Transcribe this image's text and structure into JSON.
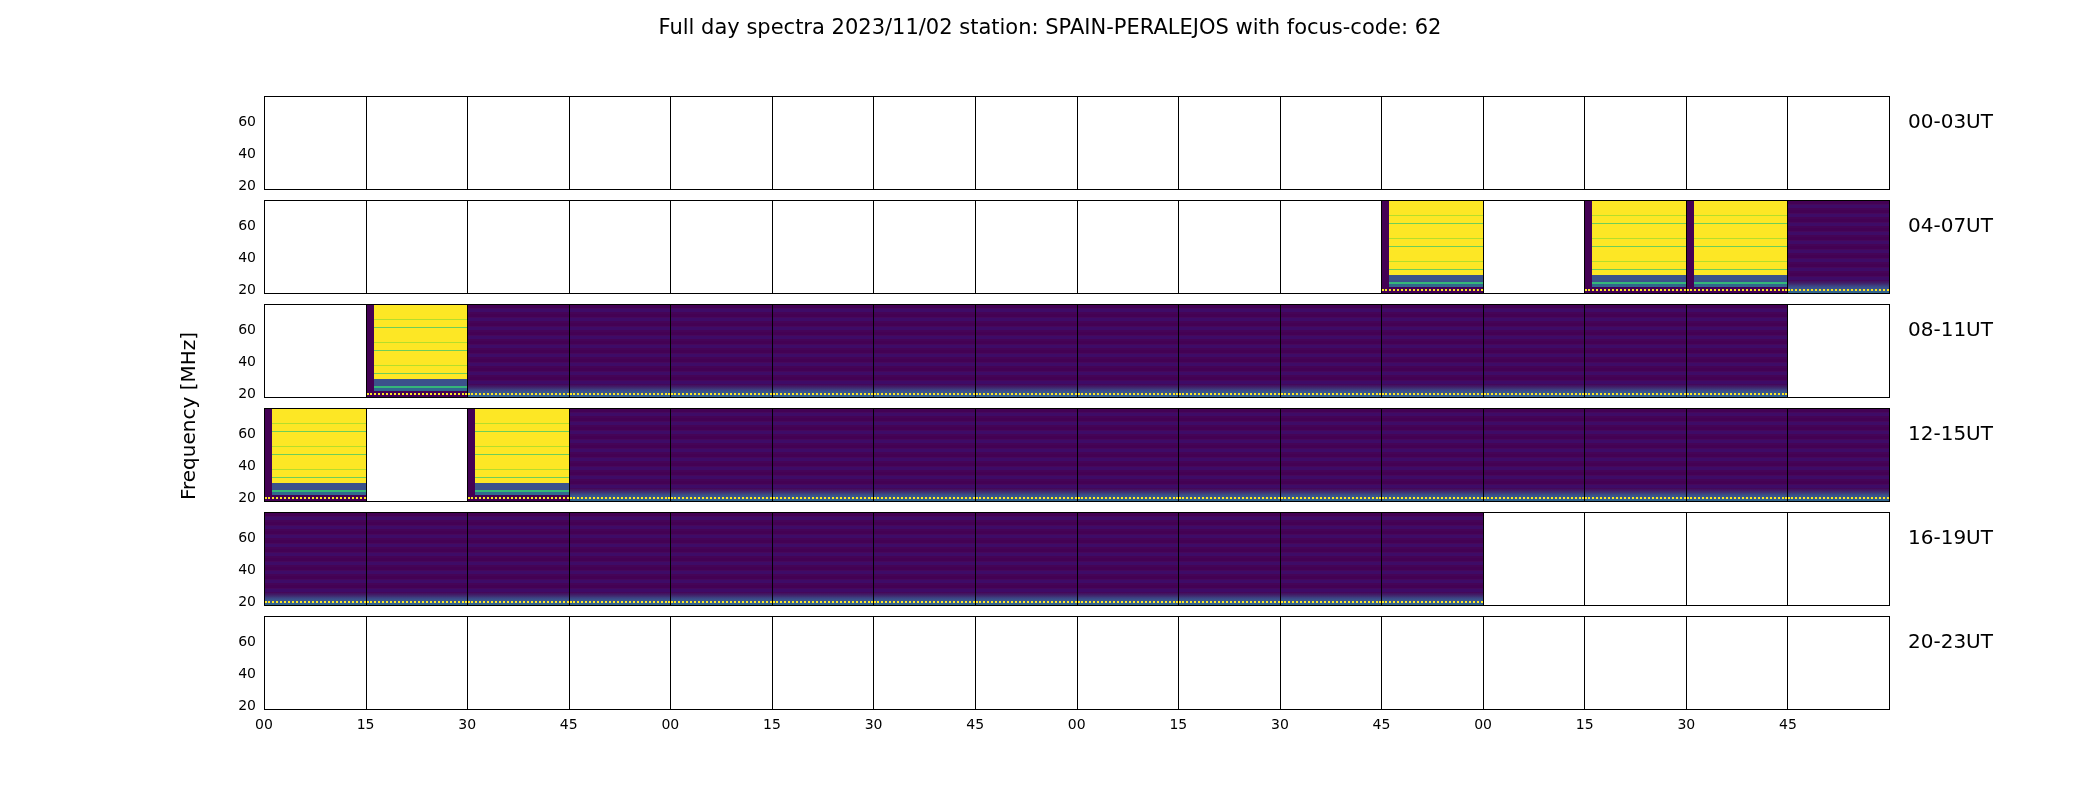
{
  "title": "Full day spectra 2023/11/02 station: SPAIN-PERALEJOS with focus-code: 62",
  "ylabel": "Frequency [MHz]",
  "rows": [
    {
      "label": "00-03UT",
      "yticks": [
        "60",
        "40",
        "20"
      ],
      "panels": [
        {
          "kind": "empty"
        },
        {
          "kind": "empty"
        },
        {
          "kind": "empty"
        },
        {
          "kind": "empty"
        },
        {
          "kind": "empty"
        },
        {
          "kind": "empty"
        },
        {
          "kind": "empty"
        },
        {
          "kind": "empty"
        },
        {
          "kind": "empty"
        },
        {
          "kind": "empty"
        },
        {
          "kind": "empty"
        },
        {
          "kind": "empty"
        },
        {
          "kind": "empty"
        },
        {
          "kind": "empty"
        },
        {
          "kind": "empty"
        },
        {
          "kind": "empty"
        }
      ]
    },
    {
      "label": "04-07UT",
      "yticks": [
        "60",
        "40",
        "20"
      ],
      "panels": [
        {
          "kind": "empty"
        },
        {
          "kind": "empty"
        },
        {
          "kind": "empty"
        },
        {
          "kind": "empty"
        },
        {
          "kind": "empty"
        },
        {
          "kind": "empty"
        },
        {
          "kind": "empty"
        },
        {
          "kind": "empty"
        },
        {
          "kind": "empty"
        },
        {
          "kind": "empty"
        },
        {
          "kind": "empty"
        },
        {
          "kind": "bright"
        },
        {
          "kind": "empty"
        },
        {
          "kind": "bright"
        },
        {
          "kind": "bright"
        },
        {
          "kind": "dark"
        }
      ]
    },
    {
      "label": "08-11UT",
      "yticks": [
        "60",
        "40",
        "20"
      ],
      "panels": [
        {
          "kind": "empty"
        },
        {
          "kind": "bright"
        },
        {
          "kind": "dark"
        },
        {
          "kind": "dark"
        },
        {
          "kind": "dark"
        },
        {
          "kind": "dark"
        },
        {
          "kind": "dark"
        },
        {
          "kind": "dark"
        },
        {
          "kind": "dark"
        },
        {
          "kind": "dark"
        },
        {
          "kind": "dark"
        },
        {
          "kind": "dark"
        },
        {
          "kind": "dark"
        },
        {
          "kind": "dark"
        },
        {
          "kind": "dark"
        },
        {
          "kind": "empty"
        }
      ]
    },
    {
      "label": "12-15UT",
      "yticks": [
        "60",
        "40",
        "20"
      ],
      "panels": [
        {
          "kind": "bright"
        },
        {
          "kind": "empty"
        },
        {
          "kind": "bright"
        },
        {
          "kind": "dark"
        },
        {
          "kind": "dark"
        },
        {
          "kind": "dark"
        },
        {
          "kind": "dark"
        },
        {
          "kind": "dark"
        },
        {
          "kind": "dark"
        },
        {
          "kind": "dark"
        },
        {
          "kind": "dark"
        },
        {
          "kind": "dark"
        },
        {
          "kind": "dark"
        },
        {
          "kind": "dark"
        },
        {
          "kind": "dark"
        },
        {
          "kind": "dark"
        }
      ]
    },
    {
      "label": "16-19UT",
      "yticks": [
        "60",
        "40",
        "20"
      ],
      "panels": [
        {
          "kind": "dark"
        },
        {
          "kind": "dark"
        },
        {
          "kind": "dark"
        },
        {
          "kind": "dark"
        },
        {
          "kind": "dark"
        },
        {
          "kind": "dark"
        },
        {
          "kind": "dark"
        },
        {
          "kind": "dark"
        },
        {
          "kind": "dark"
        },
        {
          "kind": "dark"
        },
        {
          "kind": "dark"
        },
        {
          "kind": "dark"
        },
        {
          "kind": "empty"
        },
        {
          "kind": "empty"
        },
        {
          "kind": "empty"
        },
        {
          "kind": "empty"
        }
      ]
    },
    {
      "label": "20-23UT",
      "yticks": [
        "60",
        "40",
        "20"
      ],
      "panels": [
        {
          "kind": "empty"
        },
        {
          "kind": "empty"
        },
        {
          "kind": "empty"
        },
        {
          "kind": "empty"
        },
        {
          "kind": "empty"
        },
        {
          "kind": "empty"
        },
        {
          "kind": "empty"
        },
        {
          "kind": "empty"
        },
        {
          "kind": "empty"
        },
        {
          "kind": "empty"
        },
        {
          "kind": "empty"
        },
        {
          "kind": "empty"
        },
        {
          "kind": "empty"
        },
        {
          "kind": "empty"
        },
        {
          "kind": "empty"
        },
        {
          "kind": "empty"
        }
      ]
    }
  ],
  "xticks": [
    "00",
    "15",
    "30",
    "45",
    "00",
    "15",
    "30",
    "45",
    "00",
    "15",
    "30",
    "45",
    "00",
    "15",
    "30",
    "45"
  ]
}
